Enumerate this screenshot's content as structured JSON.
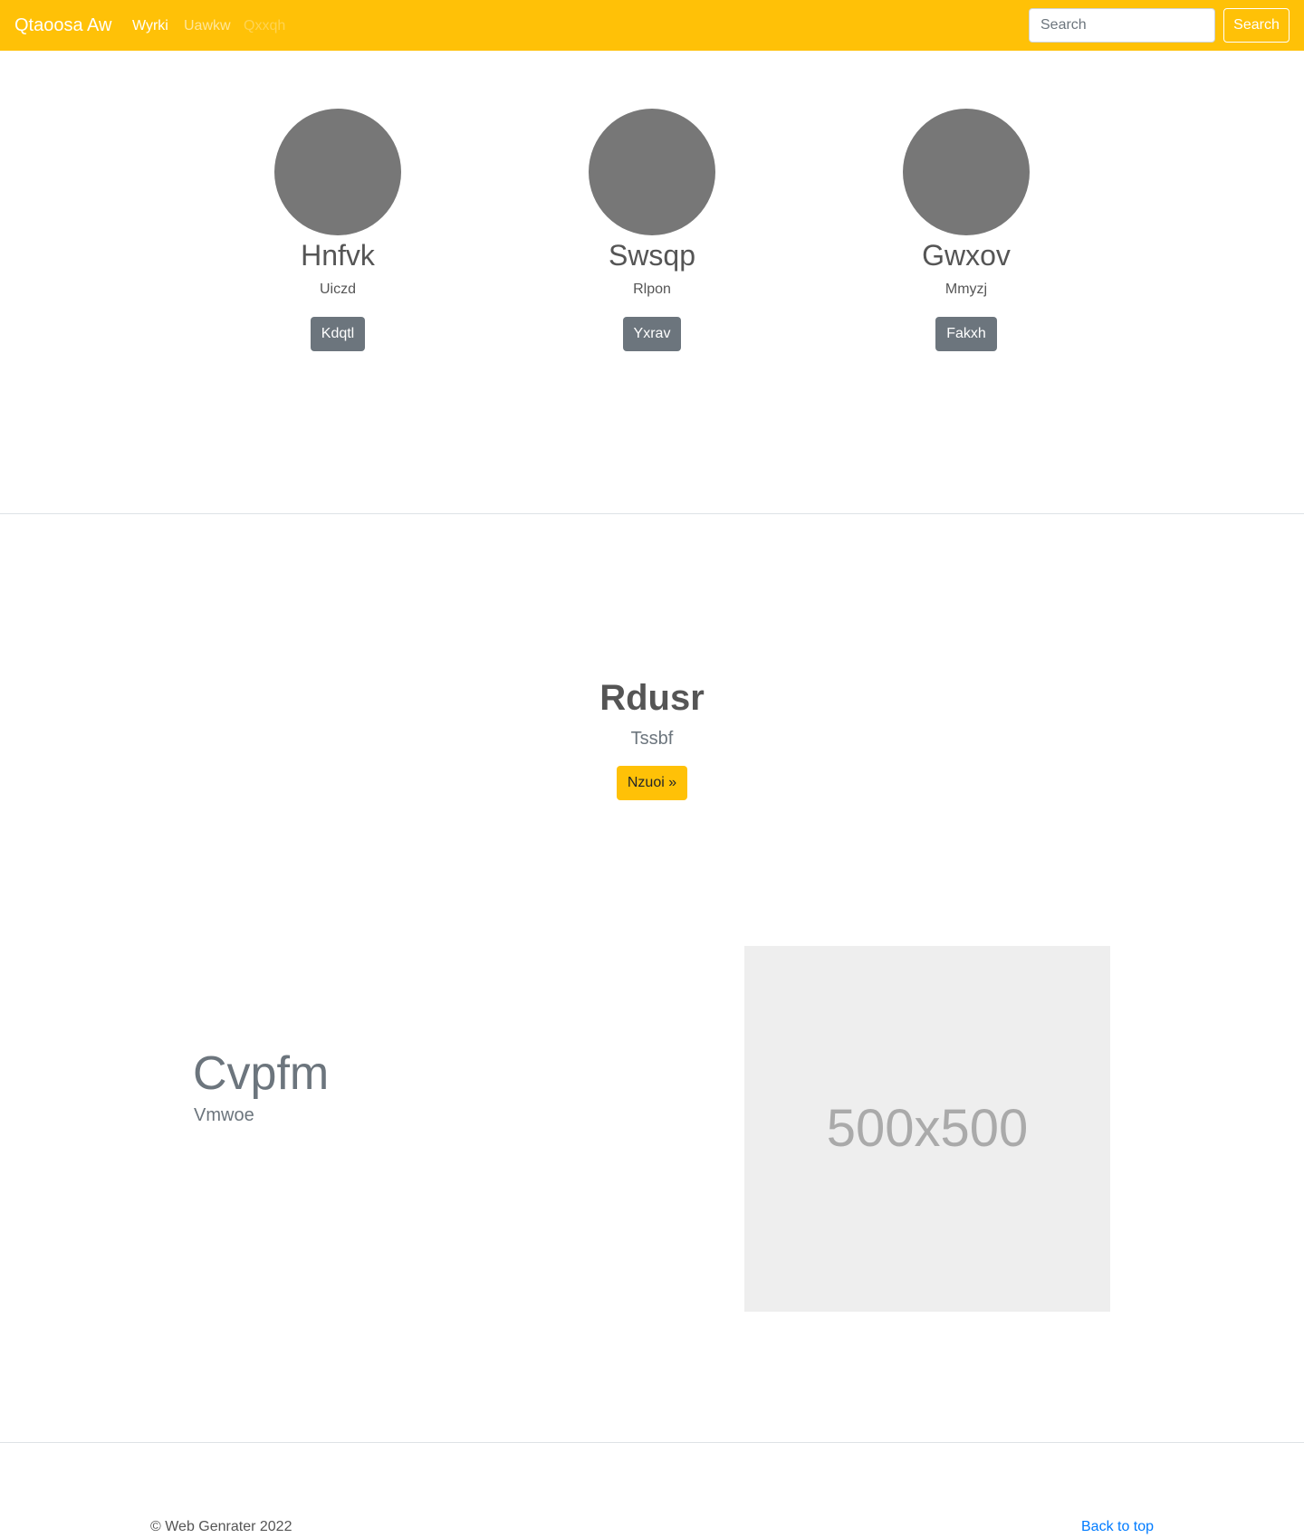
{
  "navbar": {
    "brand": "Qtaoosa Aw",
    "links": [
      {
        "label": "Wyrki",
        "state": "active"
      },
      {
        "label": "Uawkw",
        "state": "normal"
      },
      {
        "label": "Qxxqh",
        "state": "disabled"
      }
    ],
    "search": {
      "placeholder": "Search",
      "button_label": "Search"
    },
    "background_color": "#ffc107"
  },
  "team": {
    "cards": [
      {
        "name": "Hnfvk",
        "role": "Uiczd",
        "button_label": "Kdqtl"
      },
      {
        "name": "Swsqp",
        "role": "Rlpon",
        "button_label": "Yxrav"
      },
      {
        "name": "Gwxov",
        "role": "Mmyzj",
        "button_label": "Fakxh"
      }
    ]
  },
  "hero": {
    "title": "Rdusr",
    "subtitle": "Tssbf",
    "button_label": "Nzuoi »"
  },
  "feature": {
    "title": "Cvpfm",
    "subtitle": "Vmwoe",
    "image_label": "500x500"
  },
  "footer": {
    "copyright": "© Web Genrater 2022",
    "back_to_top": "Back to top"
  }
}
